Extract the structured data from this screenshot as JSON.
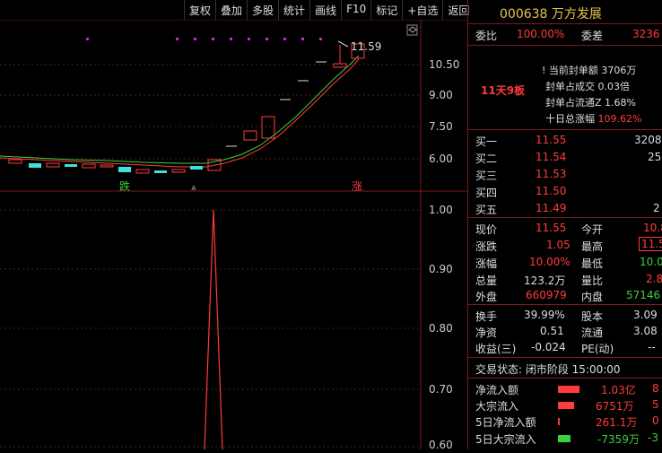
{
  "toolbar": {
    "buttons": [
      "复权",
      "叠加",
      "多股",
      "统计",
      "画线",
      "F10",
      "标记",
      "+自选",
      "返回"
    ]
  },
  "chart": {
    "upper_ticks": [
      "10.50",
      "9.00",
      "7.50",
      "6.00"
    ],
    "lower_ticks": [
      "1.00",
      "0.90",
      "0.80",
      "0.70",
      "0.60"
    ],
    "high_label": "11.59",
    "die_label": "跌",
    "zhang_label": "涨",
    "colors": {
      "up": "#ff3b3b",
      "down": "#40e0e0",
      "ma": "#3bd03b",
      "marker": "#c030c0"
    }
  },
  "stock": {
    "code_name": "000638 万方发展"
  },
  "ratio": {
    "wb_label": "委比",
    "wb_value": "100.00%",
    "wc_label": "委差",
    "wc_value": "3236"
  },
  "seal": {
    "limit_tag": "11天9板",
    "items": [
      {
        "label": "当前封单额",
        "value": "3706万"
      },
      {
        "label": "封单占成交",
        "value": "0.03倍"
      },
      {
        "label": "封单占流通Z",
        "value": "1.68%"
      },
      {
        "label": "十日总涨幅",
        "value": "109.62%"
      }
    ]
  },
  "bids": [
    {
      "label": "买一",
      "price": "11.55",
      "vol": "3208"
    },
    {
      "label": "买二",
      "price": "11.54",
      "vol": "25"
    },
    {
      "label": "买三",
      "price": "11.53",
      "vol": ""
    },
    {
      "label": "买四",
      "price": "11.50",
      "vol": ""
    },
    {
      "label": "买五",
      "price": "11.49",
      "vol": "2"
    }
  ],
  "quote": [
    {
      "l1": "现价",
      "v1": "11.55",
      "l2": "今开",
      "v2": "10.8"
    },
    {
      "l1": "涨跌",
      "v1": "1.05",
      "l2": "最高",
      "v2": "11.5"
    },
    {
      "l1": "涨幅",
      "v1": "10.00%",
      "l2": "最低",
      "v2": "10.0"
    },
    {
      "l1": "总量",
      "v1": "123.2万",
      "l2": "量比",
      "v2": "2.8"
    },
    {
      "l1": "外盘",
      "v1": "660979",
      "l2": "内盘",
      "v2": "57146"
    }
  ],
  "stats": [
    {
      "l1": "换手",
      "v1": "39.99%",
      "l2": "股本",
      "v2": "3.09"
    },
    {
      "l1": "净资",
      "v1": "0.51",
      "l2": "流通",
      "v2": "3.08"
    },
    {
      "l1": "收益(三)",
      "v1": "-0.024",
      "l2": "PE(动)",
      "v2": "--"
    }
  ],
  "trade_status": "交易状态: 闭市阶段 15:00:00",
  "flows": [
    {
      "label": "净流入额",
      "value": "1.03亿",
      "pct": "8"
    },
    {
      "label": "大宗流入",
      "value": "6751万",
      "pct": "5"
    },
    {
      "label": "5日净流入额",
      "value": "261.1万",
      "pct": "0"
    },
    {
      "label": "5日大宗流入",
      "value": "-7359万",
      "pct": "-3"
    }
  ]
}
